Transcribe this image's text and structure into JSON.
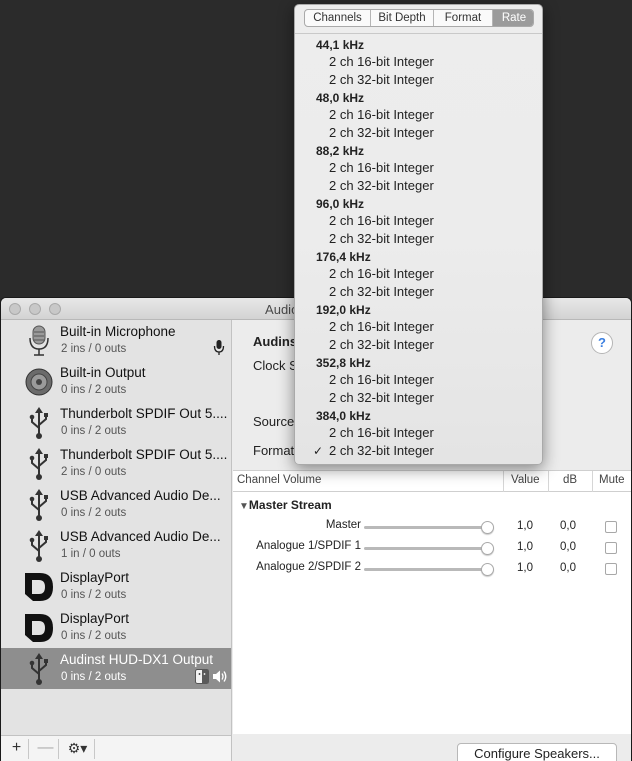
{
  "window": {
    "title": "Audio MIDI Setup"
  },
  "sidebar": {
    "devices": [
      {
        "name": "Built-in Microphone",
        "sub": "2 ins / 0 outs",
        "icon": "microphone-icon",
        "badge": "mic-badge-icon"
      },
      {
        "name": "Built-in Output",
        "sub": "0 ins / 2 outs",
        "icon": "speaker-icon"
      },
      {
        "name": "Thunderbolt SPDIF Out 5....",
        "sub": "0 ins / 2 outs",
        "icon": "usb-icon"
      },
      {
        "name": "Thunderbolt SPDIF Out 5....",
        "sub": "2 ins / 0 outs",
        "icon": "usb-icon"
      },
      {
        "name": "USB Advanced Audio De...",
        "sub": "0 ins / 2 outs",
        "icon": "usb-icon"
      },
      {
        "name": "USB Advanced Audio De...",
        "sub": "1 in / 0 outs",
        "icon": "usb-icon"
      },
      {
        "name": "DisplayPort",
        "sub": "0 ins / 2 outs",
        "icon": "displayport-icon"
      },
      {
        "name": "DisplayPort",
        "sub": "0 ins / 2 outs",
        "icon": "displayport-icon"
      },
      {
        "name": "Audinst HUD-DX1 Output",
        "sub": "0 ins / 2 outs",
        "icon": "usb-icon",
        "selected": true
      }
    ],
    "add_label": "+",
    "remove_label": "—",
    "gear_label": "⚙▾"
  },
  "main": {
    "device_title": "Audins",
    "clock_label": "Clock S",
    "source_label": "Source",
    "format_label": "Format",
    "help_label": "?",
    "table": {
      "headers": {
        "channel": "Channel Volume",
        "value": "Value",
        "db": "dB",
        "mute": "Mute"
      },
      "stream": "Master Stream",
      "rows": [
        {
          "label": "Master",
          "value": "1,0",
          "db": "0,0",
          "level": 1.0
        },
        {
          "label": "Analogue 1/SPDIF 1",
          "value": "1,0",
          "db": "0,0",
          "level": 1.0
        },
        {
          "label": "Analogue 2/SPDIF 2",
          "value": "1,0",
          "db": "0,0",
          "level": 1.0
        }
      ]
    },
    "configure_label": "Configure Speakers..."
  },
  "menu": {
    "tabs": [
      "Channels",
      "Bit Depth",
      "Format",
      "Rate"
    ],
    "active_tab": "Rate",
    "groups": [
      {
        "rate": "44,1 kHz",
        "formats": [
          "2 ch 16-bit Integer",
          "2 ch 32-bit Integer"
        ]
      },
      {
        "rate": "48,0 kHz",
        "formats": [
          "2 ch 16-bit Integer",
          "2 ch 32-bit Integer"
        ]
      },
      {
        "rate": "88,2 kHz",
        "formats": [
          "2 ch 16-bit Integer",
          "2 ch 32-bit Integer"
        ]
      },
      {
        "rate": "96,0 kHz",
        "formats": [
          "2 ch 16-bit Integer",
          "2 ch 32-bit Integer"
        ]
      },
      {
        "rate": "176,4 kHz",
        "formats": [
          "2 ch 16-bit Integer",
          "2 ch 32-bit Integer"
        ]
      },
      {
        "rate": "192,0 kHz",
        "formats": [
          "2 ch 16-bit Integer",
          "2 ch 32-bit Integer"
        ]
      },
      {
        "rate": "352,8 kHz",
        "formats": [
          "2 ch 16-bit Integer",
          "2 ch 32-bit Integer"
        ]
      },
      {
        "rate": "384,0 kHz",
        "formats": [
          "2 ch 16-bit Integer",
          "2 ch 32-bit Integer"
        ]
      }
    ],
    "checkmark": "✓",
    "selected": {
      "group": 7,
      "format": 1
    }
  }
}
